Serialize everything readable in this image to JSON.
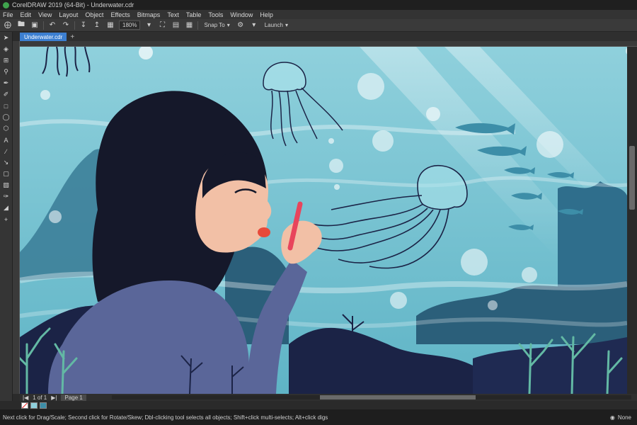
{
  "window": {
    "title": "CorelDRAW 2019 (64-Bit) - Underwater.cdr"
  },
  "menu": [
    "File",
    "Edit",
    "View",
    "Layout",
    "Object",
    "Effects",
    "Bitmaps",
    "Text",
    "Table",
    "Tools",
    "Window",
    "Help"
  ],
  "toolbar": {
    "zoom_value": "180%",
    "snap_label": "Snap To",
    "launch_label": "Launch"
  },
  "document": {
    "tab_label": "Underwater.cdr",
    "add_tab": "+"
  },
  "pages": {
    "counter": "1 of 1",
    "page_tab": "Page 1"
  },
  "status": {
    "hint": "Next click for Drag/Scale; Second click for Rotate/Skew; Dbl-clicking tool selects all objects; Shift+click multi-selects; Alt+click digs",
    "fill_label": "None"
  },
  "colors": {
    "water_top": "#8fd0dc",
    "water_bottom": "#5fb4c6",
    "navy": "#1b2346",
    "hair": "#15182a",
    "skin": "#f2c0a6",
    "lips": "#e84a3a",
    "shirt": "#5a6699",
    "reef": "#2b5f7a",
    "reef_dark": "#1f4a66"
  }
}
